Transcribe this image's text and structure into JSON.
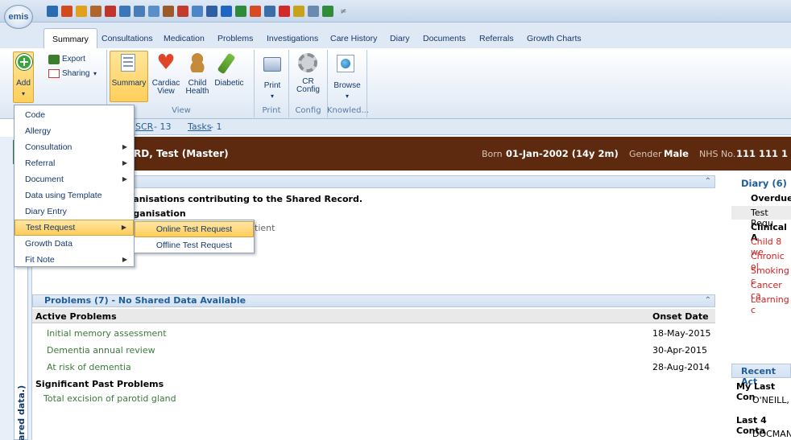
{
  "app": {
    "logo_text": "emis"
  },
  "quick_access": {
    "icons": [
      {
        "name": "back-icon",
        "color": "#2b6cb0"
      },
      {
        "name": "home-icon",
        "color": "#d34a1f"
      },
      {
        "name": "edit-icon",
        "color": "#e2a11a"
      },
      {
        "name": "users-icon",
        "color": "#b0652a"
      },
      {
        "name": "book-icon",
        "color": "#c1342b"
      },
      {
        "name": "scan-icon",
        "color": "#3a77b8"
      },
      {
        "name": "document-icon",
        "color": "#4a7db8"
      },
      {
        "name": "document-lines-icon",
        "color": "#5a8fc9"
      },
      {
        "name": "people-icon",
        "color": "#9a5a2a"
      },
      {
        "name": "calendar-icon",
        "color": "#c23b2e"
      },
      {
        "name": "report-icon",
        "color": "#4d86c6"
      },
      {
        "name": "search-person-icon",
        "color": "#2e5fa3"
      },
      {
        "name": "info-icon",
        "color": "#1f66c2"
      },
      {
        "name": "pen-icon",
        "color": "#2e8b3a"
      },
      {
        "name": "flask-icon",
        "color": "#d84a23"
      },
      {
        "name": "print-icon",
        "color": "#3b6ea8"
      },
      {
        "name": "tick-icon",
        "color": "#d12a2a"
      },
      {
        "name": "connect-icon",
        "color": "#c7a21b"
      },
      {
        "name": "settings-icon",
        "color": "#6b8ab0"
      },
      {
        "name": "grid-icon",
        "color": "#2f8d3a"
      }
    ],
    "dropdown": "≠"
  },
  "tabs": [
    "Summary",
    "Consultations",
    "Medication",
    "Problems",
    "Investigations",
    "Care History",
    "Diary",
    "Documents",
    "Referrals",
    "Growth Charts"
  ],
  "ribbon": {
    "add": "Add",
    "export": "Export",
    "sharing": "Sharing",
    "view": {
      "summary": "Summary",
      "cardiac": "Cardiac\nView",
      "child": "Child\nHealth",
      "diabetic": "Diabetic",
      "group": "View"
    },
    "print": {
      "button": "Print",
      "group": "Print"
    },
    "config": {
      "button": "CR\nConfig",
      "group": "Config"
    },
    "knowledge": {
      "button": "Browse",
      "group": "Knowled..."
    }
  },
  "subbar": {
    "scr": "SCR",
    "scr_count": " - 13",
    "tasks": "Tasks",
    "tasks_count": " - 1"
  },
  "patient": {
    "name": "RD, Test (Master)",
    "born_label": "Born",
    "born_value": "01-Jan-2002 (14y 2m)",
    "gender_label": "Gender",
    "gender_value": "Male",
    "nhs_label": "NHS No.",
    "nhs_value": "111 111 1"
  },
  "shared_panel": {
    "line1": "rganisations contributing to the Shared Record.",
    "line2": "rganisation",
    "line3": "tient"
  },
  "problems": {
    "header": "Problems (7) - No Shared Data Available",
    "col_active": "Active Problems",
    "col_onset": "Onset Date",
    "active": [
      {
        "name": "Initial memory assessment",
        "date": "18-May-2015"
      },
      {
        "name": "Dementia annual review",
        "date": "30-Apr-2015"
      },
      {
        "name": "At risk of dementia",
        "date": "28-Aug-2014"
      }
    ],
    "significant_header": "Significant Past Problems",
    "significant": [
      {
        "name": "Total excision of parotid gland"
      }
    ]
  },
  "diary": {
    "header": "Diary (6)",
    "overdue": "Overdue",
    "test_req": "Test Requ",
    "clinical": "Clinical A",
    "items": [
      "Child 8 we",
      "Chronic ol",
      "Smoking c",
      "Cancer ca",
      "Learning c"
    ]
  },
  "recent": {
    "header": "Recent Act",
    "my_last": "My Last Con",
    "my_last_name": "O'NEILL,",
    "last4": "Last 4 Conta",
    "last4_name": "DOCMAN"
  },
  "sidebar": {
    "vertical_text": "ared data.)"
  },
  "add_menu": {
    "items": [
      {
        "label": "Code",
        "arrow": false
      },
      {
        "label": "Allergy",
        "arrow": false
      },
      {
        "label": "Consultation",
        "arrow": true
      },
      {
        "label": "Referral",
        "arrow": true
      },
      {
        "label": "Document",
        "arrow": true
      },
      {
        "label": "Data using Template",
        "arrow": false
      },
      {
        "label": "Diary Entry",
        "arrow": false
      },
      {
        "label": "Test Request",
        "arrow": true
      },
      {
        "label": "Growth Data",
        "arrow": false
      },
      {
        "label": "Fit Note",
        "arrow": true
      }
    ],
    "highlighted_index": 7
  },
  "test_request_menu": {
    "items": [
      "Online Test Request",
      "Offline Test Request"
    ],
    "highlighted_index": 0
  },
  "colors": {
    "banner": "#5e2a0f",
    "menu_highlight": "#ffcc58",
    "link": "#1f5e9a",
    "overdue_red": "#d21f1f",
    "problem_green": "#3c7a3c"
  }
}
